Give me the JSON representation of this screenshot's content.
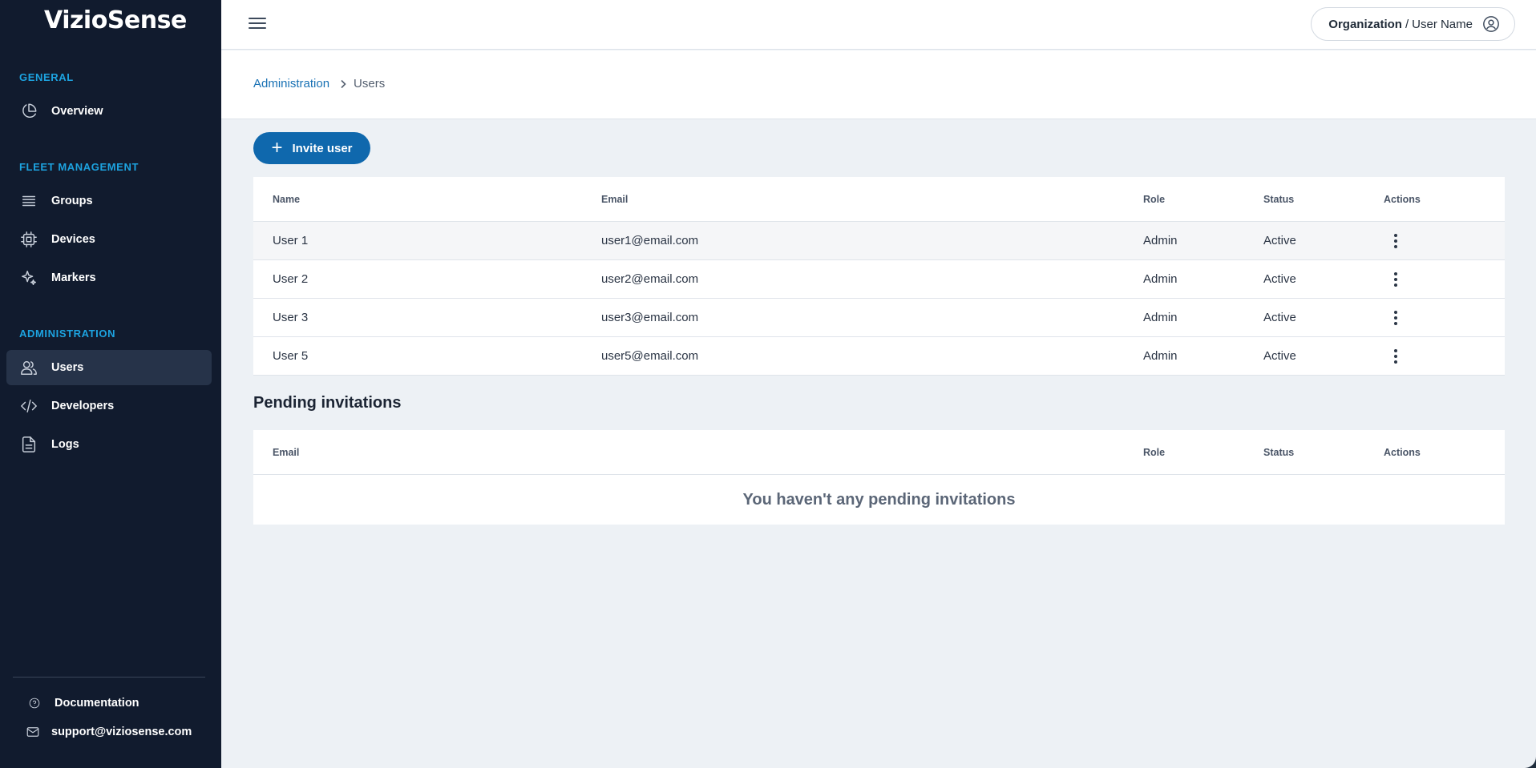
{
  "app": {
    "brand": "VizioSense"
  },
  "sidebar": {
    "sections": [
      {
        "title": "GENERAL"
      },
      {
        "title": "FLEET MANAGEMENT"
      },
      {
        "title": "ADMINISTRATION"
      }
    ],
    "items": [
      {
        "label": "Overview",
        "icon": "pie-chart-icon"
      },
      {
        "label": "Groups",
        "icon": "list-icon"
      },
      {
        "label": "Devices",
        "icon": "chip-icon"
      },
      {
        "label": "Markers",
        "icon": "sparkle-icon"
      },
      {
        "label": "Users",
        "icon": "users-icon",
        "active": true
      },
      {
        "label": "Developers",
        "icon": "code-icon"
      },
      {
        "label": "Logs",
        "icon": "file-icon"
      }
    ],
    "footer": [
      {
        "label": "Documentation",
        "icon": "help-circle-icon"
      },
      {
        "label": "support@viziosense.com",
        "icon": "mail-icon"
      }
    ]
  },
  "header": {
    "org": "Organization",
    "separator": "/",
    "user": "User Name"
  },
  "breadcrumb": {
    "parent": "Administration",
    "current": "Users"
  },
  "actions": {
    "invite_label": "Invite user"
  },
  "users_table": {
    "columns": {
      "name": "Name",
      "email": "Email",
      "role": "Role",
      "status": "Status",
      "actions": "Actions"
    },
    "rows": [
      {
        "name": "User 1",
        "email": "user1@email.com",
        "role": "Admin",
        "status": "Active"
      },
      {
        "name": "User 2",
        "email": "user2@email.com",
        "role": "Admin",
        "status": "Active"
      },
      {
        "name": "User 3",
        "email": "user3@email.com",
        "role": "Admin",
        "status": "Active"
      },
      {
        "name": "User 5",
        "email": "user5@email.com",
        "role": "Admin",
        "status": "Active"
      }
    ]
  },
  "pending": {
    "title": "Pending invitations",
    "columns": {
      "email": "Email",
      "role": "Role",
      "status": "Status",
      "actions": "Actions"
    },
    "empty_message": "You haven't any pending invitations"
  },
  "colors": {
    "sidebar_bg": "#111b2e",
    "accent_blue": "#0f68ad",
    "section_title": "#1da3e0",
    "main_bg": "#edf1f5"
  }
}
